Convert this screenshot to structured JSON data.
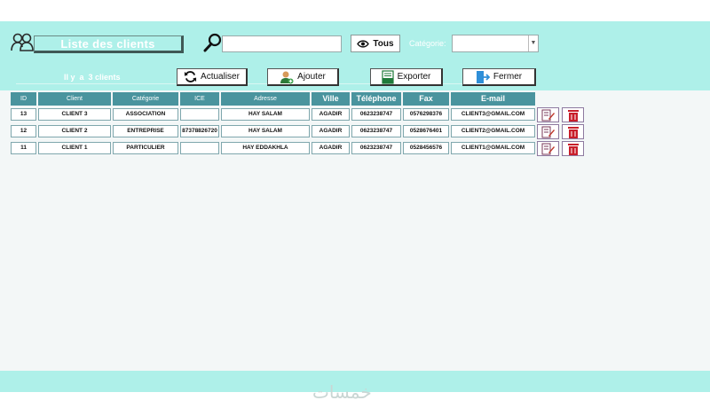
{
  "header": {
    "title": "Liste des clients",
    "search_value": "",
    "tous_label": "Tous",
    "category_label": "Catégorie:",
    "category_value": "",
    "count_text": "Il y  a  3 clients"
  },
  "toolbar": {
    "actualiser": "Actualiser",
    "ajouter": "Ajouter",
    "exporter": "Exporter",
    "fermer": "Fermer"
  },
  "table": {
    "columns": [
      "ID",
      "Client",
      "Catégorie",
      "ICE",
      "Adresse",
      "Ville",
      "Téléphone",
      "Fax",
      "E-mail"
    ],
    "rows": [
      {
        "id": "13",
        "client": "CLIENT 3",
        "categorie": "ASSOCIATION",
        "ice": "",
        "adresse": "HAY SALAM",
        "ville": "AGADIR",
        "telephone": "0623238747",
        "fax": "0576298376",
        "email": "CLIENT3@GMAIL.COM"
      },
      {
        "id": "12",
        "client": "CLIENT 2",
        "categorie": "ENTREPRISE",
        "ice": "87378826720",
        "adresse": "HAY SALAM",
        "ville": "AGADIR",
        "telephone": "0623238747",
        "fax": "0528676401",
        "email": "CLIENT2@GMAIL.COM"
      },
      {
        "id": "11",
        "client": "CLIENT 1",
        "categorie": "PARTICULIER",
        "ice": "",
        "adresse": "HAY EDDAKHLA",
        "ville": "AGADIR",
        "telephone": "0623238747",
        "fax": "0528456576",
        "email": "CLIENT1@GMAIL.COM"
      }
    ]
  },
  "watermark": "خمسات",
  "colors": {
    "header_bg": "#aef0e9",
    "column_header_bg": "#4a949e",
    "delete_red": "#c81e2a"
  },
  "icons": {
    "app": "users-icon",
    "search": "magnifier-icon",
    "tous": "eye-icon",
    "actualiser": "refresh-icon",
    "ajouter": "add-user-icon",
    "exporter": "excel-icon",
    "fermer": "exit-icon",
    "edit": "edit-icon",
    "delete": "trash-icon"
  }
}
